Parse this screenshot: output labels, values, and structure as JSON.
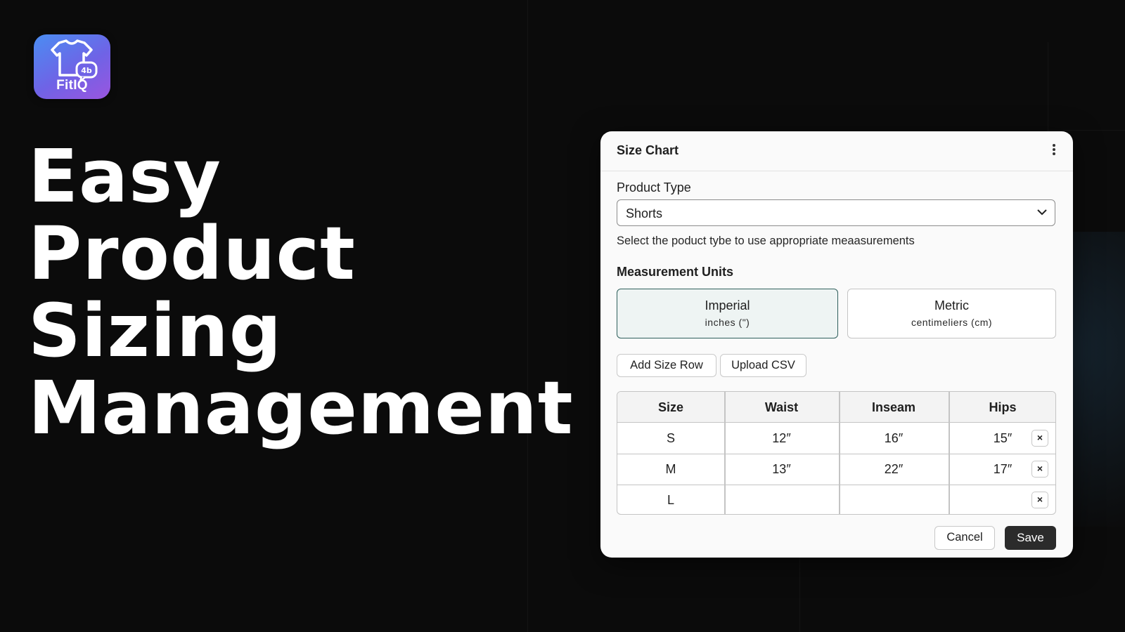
{
  "brand": {
    "name": "FitIQ",
    "icon": "tshirt-chat-icon"
  },
  "headline": {
    "lines": [
      "Easy",
      "Product",
      "Sizing",
      "Management"
    ]
  },
  "panel": {
    "title": "Size Chart",
    "menu_icon": "kebab-menu-icon",
    "product_type": {
      "label": "Product Type",
      "value": "Shorts",
      "help": "Select the poduct tybe to use appropriate meaasurements"
    },
    "units": {
      "label": "Measurement Units",
      "selected": "Imperial",
      "options": [
        {
          "name": "Imperial",
          "sub": "inches (\")"
        },
        {
          "name": "Metric",
          "sub": "centimeliers (cm)"
        }
      ]
    },
    "actions": {
      "add_row": "Add Size Row",
      "upload_csv": "Upload CSV"
    },
    "table": {
      "headers": [
        "Size",
        "Waist",
        "Inseam",
        "Hips"
      ],
      "rows": [
        {
          "size": "S",
          "waist": "12″",
          "inseam": "16″",
          "hips": "15″",
          "remove": "×"
        },
        {
          "size": "M",
          "waist": "13″",
          "inseam": "22″",
          "hips": "17″",
          "remove": "×"
        },
        {
          "size": "L",
          "waist": "",
          "inseam": "",
          "hips": "",
          "remove": "×"
        }
      ]
    },
    "footer": {
      "cancel": "Cancel",
      "save": "Save"
    }
  }
}
